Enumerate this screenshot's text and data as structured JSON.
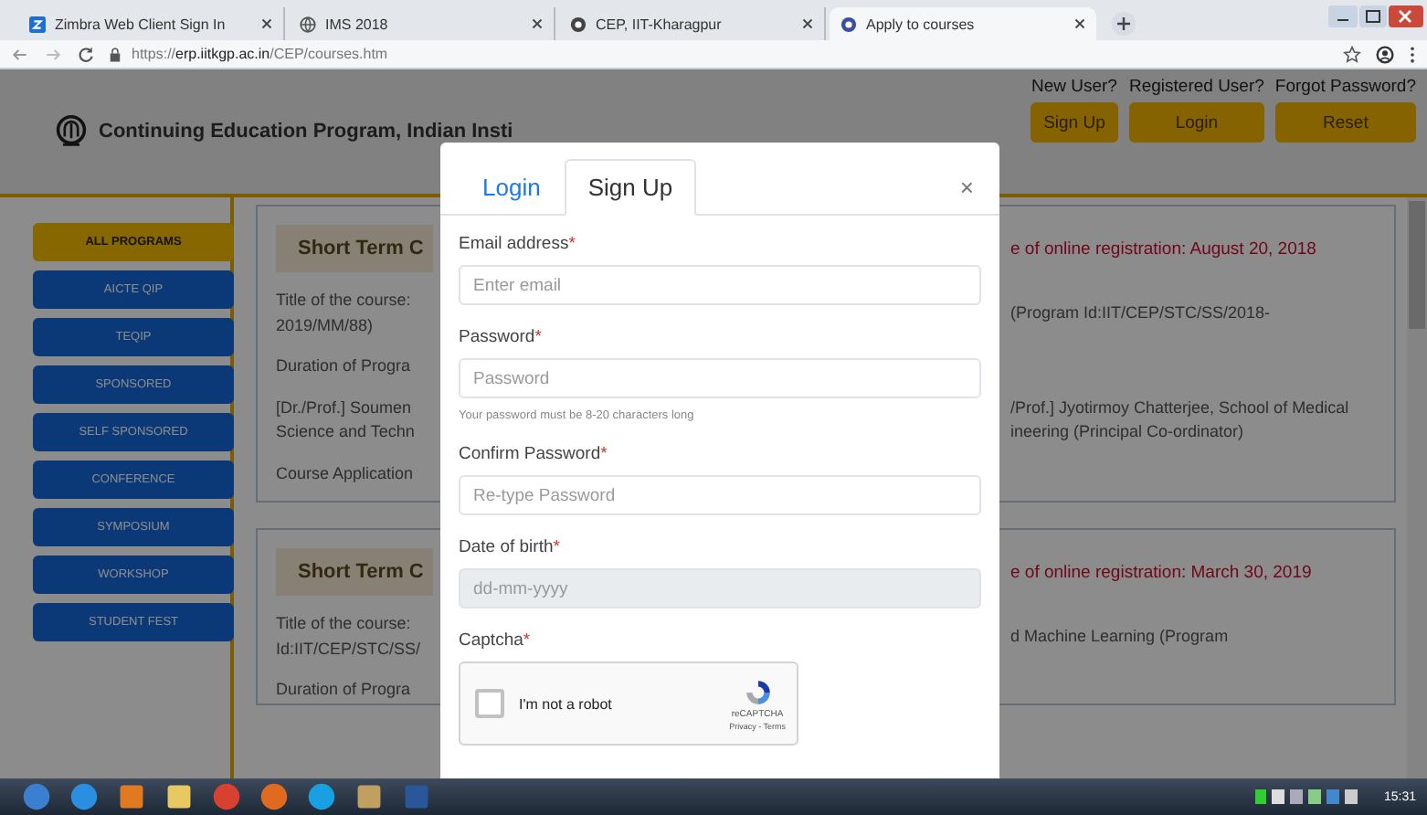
{
  "browser": {
    "tabs": [
      {
        "title": "Zimbra Web Client Sign In",
        "kind": "square",
        "selected": false
      },
      {
        "title": "IMS 2018",
        "kind": "globe",
        "selected": false
      },
      {
        "title": "CEP, IIT-Kharagpur",
        "kind": "emblem",
        "selected": false
      },
      {
        "title": "Apply to courses",
        "kind": "emblem",
        "selected": true
      }
    ],
    "address": {
      "scheme": "https://",
      "host": "erp.iitkgp.ac.in",
      "path": "/CEP/courses.htm"
    }
  },
  "page": {
    "header": {
      "title": "Continuing Education Program, Indian Insti",
      "actions": [
        {
          "caption": "New User?",
          "button": "Sign Up"
        },
        {
          "caption": "Registered User?",
          "button": "Login"
        },
        {
          "caption": "Forgot Password?",
          "button": "Reset"
        }
      ]
    },
    "sidebar": [
      {
        "label": "ALL PROGRAMS",
        "selected": true
      },
      {
        "label": "AICTE QIP",
        "selected": false
      },
      {
        "label": "TEQIP",
        "selected": false
      },
      {
        "label": "SPONSORED",
        "selected": false
      },
      {
        "label": "SELF SPONSORED",
        "selected": false
      },
      {
        "label": "CONFERENCE",
        "selected": false
      },
      {
        "label": "SYMPOSIUM",
        "selected": false
      },
      {
        "label": "WORKSHOP",
        "selected": false
      },
      {
        "label": "STUDENT FEST",
        "selected": false
      }
    ],
    "cards": [
      {
        "rows": [
          {
            "kind": "heading",
            "left": "Short Term C",
            "right": "e of online registration: August 20, 2018"
          },
          {
            "kind": "text",
            "left": "Title of the course:\n2019/MM/88)",
            "right": "(Program Id:IIT/CEP/STC/SS/2018-"
          },
          {
            "kind": "text",
            "left": "Duration of Progra",
            "right": ""
          },
          {
            "kind": "text",
            "left": "[Dr./Prof.] Soumen\nScience and Techn",
            "right": "/Prof.] Jyotirmoy Chatterjee, School of Medical\nineering (Principal Co-ordinator)"
          },
          {
            "kind": "text",
            "left": "Course Application",
            "right": ""
          }
        ]
      },
      {
        "rows": [
          {
            "kind": "heading",
            "left": "Short Term C",
            "right": "e of online registration: March 30, 2019"
          },
          {
            "kind": "text",
            "left": "Title of the course:\nId:IIT/CEP/STC/SS/",
            "right": "d Machine Learning (Program"
          },
          {
            "kind": "text",
            "left": "Duration of Progra",
            "right": ""
          }
        ]
      }
    ]
  },
  "modal": {
    "tabs": [
      {
        "label": "Login",
        "selected": false
      },
      {
        "label": "Sign Up",
        "selected": true
      }
    ],
    "close": "×",
    "fields": [
      {
        "label": "Email address",
        "mark": "*",
        "placeholder": "Enter email",
        "disabled": false
      },
      {
        "label": "Password",
        "mark": "*",
        "placeholder": "Password",
        "hint": "Your password must be 8-20 characters long",
        "disabled": false
      },
      {
        "label": "Confirm Password",
        "mark": "*",
        "placeholder": "Re-type Password",
        "disabled": false
      },
      {
        "label": "Date of birth",
        "mark": "*",
        "placeholder": "dd-mm-yyyy",
        "disabled": true
      }
    ],
    "captcha": {
      "label": "Captcha",
      "mark": "*",
      "checked": false,
      "text": "I'm not a robot",
      "brand": "reCAPTCHA",
      "links": "Privacy - Terms"
    }
  },
  "taskbar": {
    "clock": "15:31"
  }
}
